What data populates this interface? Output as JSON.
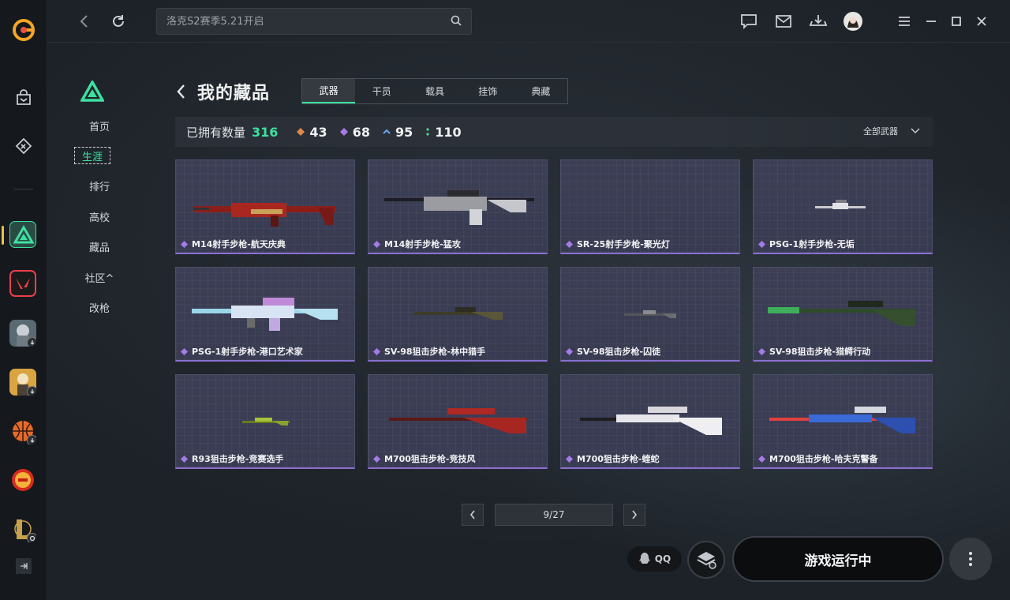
{
  "search": {
    "placeholder": "洛克S2赛季5.21开启"
  },
  "subnav": {
    "items": [
      {
        "label": "首页"
      },
      {
        "label": "生涯"
      },
      {
        "label": "排行"
      },
      {
        "label": "高校"
      },
      {
        "label": "藏品"
      },
      {
        "label": "社区^"
      },
      {
        "label": "改枪"
      }
    ],
    "active_index": 1
  },
  "page": {
    "title": "我的藏品"
  },
  "tabs": [
    {
      "label": "武器"
    },
    {
      "label": "干员"
    },
    {
      "label": "载具"
    },
    {
      "label": "挂饰"
    },
    {
      "label": "典藏"
    }
  ],
  "stats": {
    "owned_label": "已拥有数量",
    "owned_total": "316",
    "rarity": [
      {
        "icon": "orange-diamond-icon",
        "color": "#e0884a",
        "value": "43"
      },
      {
        "icon": "purple-diamond-icon",
        "color": "#a57be8",
        "value": "68"
      },
      {
        "icon": "blue-chevron-icon",
        "color": "#6aa8e8",
        "value": "95"
      },
      {
        "icon": "green-dots-icon",
        "color": "#4fd88e",
        "value": "110"
      }
    ],
    "filter_label": "全部武器"
  },
  "weapons": [
    {
      "name": "M14射手步枪-航天庆典"
    },
    {
      "name": "M14射手步枪-猛攻"
    },
    {
      "name": "SR-25射手步枪-聚光灯"
    },
    {
      "name": "PSG-1射手步枪-无垢"
    },
    {
      "name": "PSG-1射手步枪-港口艺术家"
    },
    {
      "name": "SV-98狙击步枪-林中猎手"
    },
    {
      "name": "SV-98狙击步枪-囚徒"
    },
    {
      "name": "SV-98狙击步枪-猎鳄行动"
    },
    {
      "name": "R93狙击步枪-竞赛选手"
    },
    {
      "name": "M700狙击步枪-竞技风"
    },
    {
      "name": "M700狙击步枪-蝰蛇"
    },
    {
      "name": "M700狙击步枪-哈夫克警备"
    }
  ],
  "pager": {
    "label": "9/27"
  },
  "bottom": {
    "qq_label": "QQ",
    "launch_label": "游戏运行中"
  },
  "colors": {
    "accent": "#3ee0a0",
    "card_border": "#8a6fd1",
    "card_bg": "#393b52"
  }
}
